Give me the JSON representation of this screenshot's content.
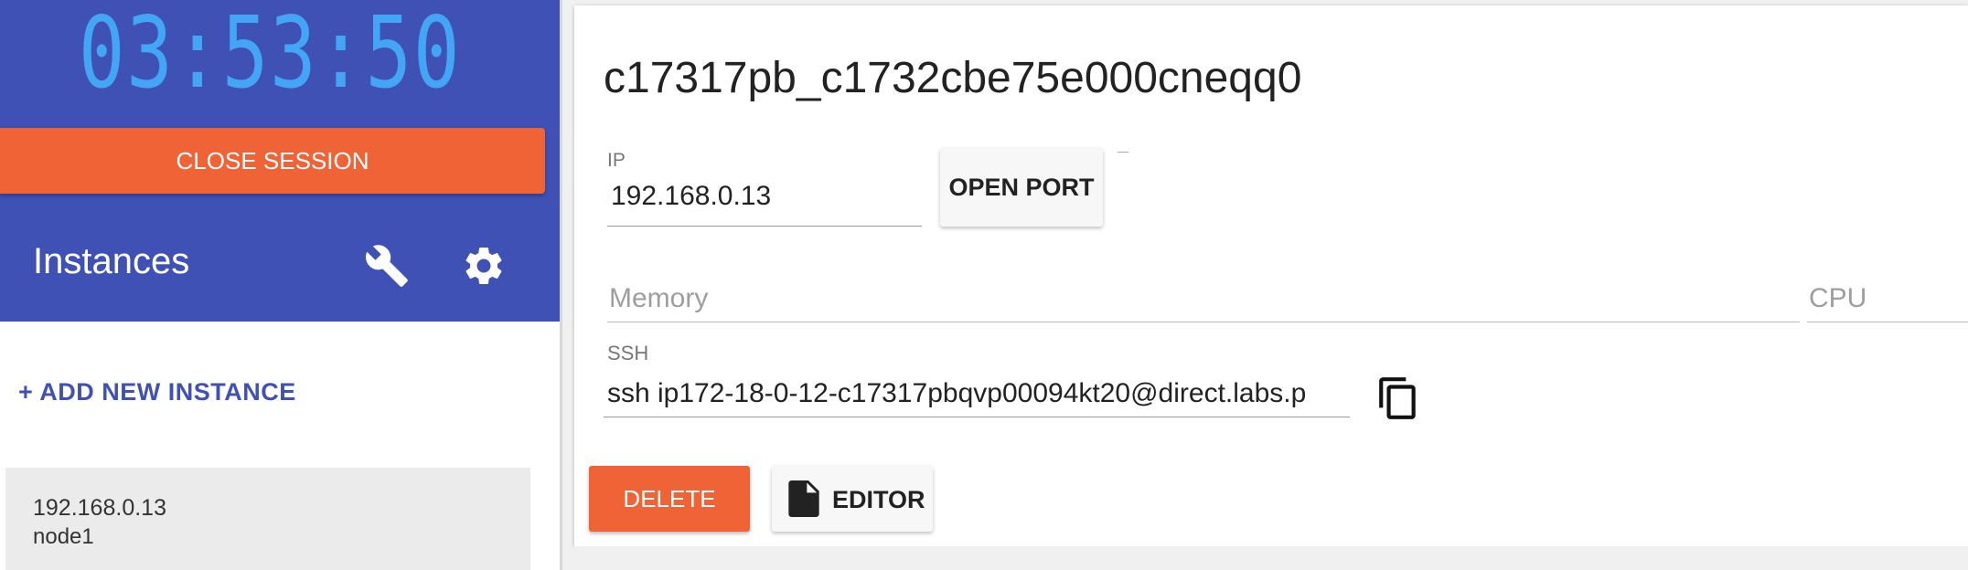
{
  "sidebar": {
    "timer": "03:53:50",
    "close_session_label": "CLOSE SESSION",
    "instances_title": "Instances",
    "add_instance_label": "+ ADD NEW INSTANCE",
    "icons": {
      "settings_tools": "wrench-icon",
      "settings": "gear-icon"
    },
    "instances": [
      {
        "ip": "192.168.0.13",
        "name": "node1"
      }
    ]
  },
  "instance": {
    "title": "c17317pb_c1732cbe75e000cneqq0",
    "ip_label": "IP",
    "ip_value": "192.168.0.13",
    "open_port_label": "OPEN PORT",
    "memory_placeholder": "Memory",
    "cpu_placeholder": "CPU",
    "ssh_label": "SSH",
    "ssh_value": "ssh ip172-18-0-12-c17317pbqvp00094kt20@direct.labs.p",
    "delete_label": "DELETE",
    "editor_label": "EDITOR"
  },
  "colors": {
    "sidebar_bg": "#3f51b5",
    "timer": "#42a5f5",
    "accent_orange": "#f06337",
    "link_blue": "#3f51b5"
  }
}
